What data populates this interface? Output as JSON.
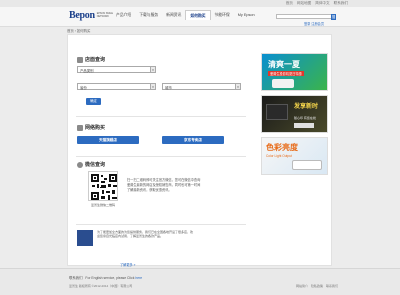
{
  "toplinks": [
    "首页",
    "网站地图",
    "简体中文",
    "联系我们"
  ],
  "header": {
    "logo_mark": "Bepon",
    "logo_sub": "EPSON SMILE NETWORK",
    "nav": [
      "产品介绍",
      "下载与服务",
      "新闻资讯",
      "如何购买",
      "节能环保",
      "My Epson"
    ],
    "active_nav": "如何购买",
    "search_placeholder": "",
    "search_button": "搜",
    "login_link": "登录  注册会员"
  },
  "breadcrumb": "首页 › 如何购买",
  "store_query": {
    "title": "店面查询",
    "category_field": "产品类别",
    "province_field": "省份",
    "city_field": "城市",
    "query_button": "确定"
  },
  "online": {
    "title": "网络购买",
    "tmall_button": "天猫旗舰店",
    "jd_button": "京东专卖店"
  },
  "wechat": {
    "title": "微信查询",
    "qr_caption": "爱普生微信二维码",
    "text": "扫一扫二维码即可关注官方微信，您可在微信中查询爱普生最新的网店及授权销售商，同时也可第一时间了解最新资讯，获取优惠资讯。"
  },
  "bottom_note": {
    "text": "为了能更加全方面的为您提供服务，我们已在全国各地开设了很多店，欢迎您亲自光临店内试用、了解爱普生的各款产品。",
    "more": "了解更多 »"
  },
  "banners": [
    {
      "title": "清爽一夏",
      "sub": "爱普生投影机夏日特惠"
    },
    {
      "title": "发享新时",
      "sub": "随心印 有您在线"
    },
    {
      "title": "色彩亮度",
      "sub": "Color Light Output"
    }
  ],
  "footer": {
    "row1_prefix": "联系我们",
    "row1_text": "For English service, please Click",
    "row1_link": "here",
    "row2": "爱普生 版权所有 ©2012-2014（中国）有限公司",
    "right_links": [
      "网站简介",
      "隐私政策",
      "联系我们"
    ]
  }
}
